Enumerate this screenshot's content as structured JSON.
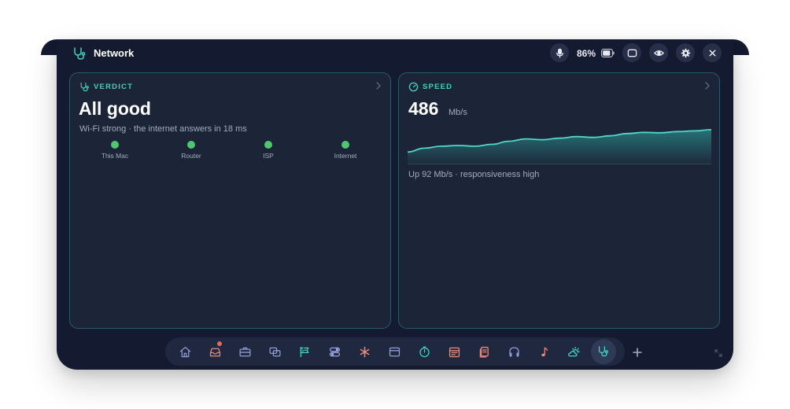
{
  "app": {
    "title": "Network",
    "icon": "stethoscope-icon"
  },
  "titlebar": {
    "battery_percent": "86%",
    "battery_level": 0.86,
    "buttons": [
      "microphone-icon",
      "window-icon",
      "eye-icon",
      "gear-icon",
      "close-icon"
    ]
  },
  "verdict": {
    "label": "VERDICT",
    "title": "All good",
    "subtitle": "Wi-Fi strong · the internet answers in 18 ms",
    "hops": [
      {
        "label": "This Mac",
        "status": "ok"
      },
      {
        "label": "Router",
        "status": "ok"
      },
      {
        "label": "ISP",
        "status": "ok"
      },
      {
        "label": "Internet",
        "status": "ok"
      }
    ]
  },
  "speed": {
    "label": "SPEED",
    "value": "486",
    "unit": "Mb/s",
    "subtitle": "Up 92 Mb/s · responsiveness high"
  },
  "chart_data": {
    "type": "area",
    "title": "",
    "xlabel": "",
    "ylabel": "",
    "ylim": [
      0,
      1
    ],
    "series": [
      {
        "values": [
          0.3,
          0.4,
          0.45,
          0.47,
          0.45,
          0.5,
          0.58,
          0.64,
          0.62,
          0.66,
          0.7,
          0.68,
          0.72,
          0.78,
          0.81,
          0.8,
          0.83,
          0.85,
          0.88
        ]
      }
    ]
  },
  "dock": {
    "items": [
      {
        "name": "home-icon",
        "color": "#8e9bd6"
      },
      {
        "name": "inbox-icon",
        "color": "#e08a7a",
        "badge": true
      },
      {
        "name": "briefcase-icon",
        "color": "#8e9bd6"
      },
      {
        "name": "windows-icon",
        "color": "#8e9bd6"
      },
      {
        "name": "flag-icon",
        "color": "#3fd3c1"
      },
      {
        "name": "toggles-icon",
        "color": "#9aa6e0"
      },
      {
        "name": "asterisk-icon",
        "color": "#ef8a78"
      },
      {
        "name": "window-list-icon",
        "color": "#8e9bd6"
      },
      {
        "name": "timer-icon",
        "color": "#3fd3c1"
      },
      {
        "name": "calendar-icon",
        "color": "#ef8a78"
      },
      {
        "name": "documents-icon",
        "color": "#ef8a78"
      },
      {
        "name": "headphones-icon",
        "color": "#8e9bd6"
      },
      {
        "name": "music-note-icon",
        "color": "#ef8a78"
      },
      {
        "name": "weather-icon",
        "color": "#3fd3c1"
      },
      {
        "name": "stethoscope-icon",
        "color": "#3fd3c1",
        "active": true
      }
    ],
    "add_button": "plus-icon"
  },
  "colors": {
    "accent": "#3fd3c1",
    "ok": "#4cc96c",
    "window_bg": "#141a30",
    "panel_bg": "#1c2438",
    "panel_border": "#2a5a6a"
  }
}
